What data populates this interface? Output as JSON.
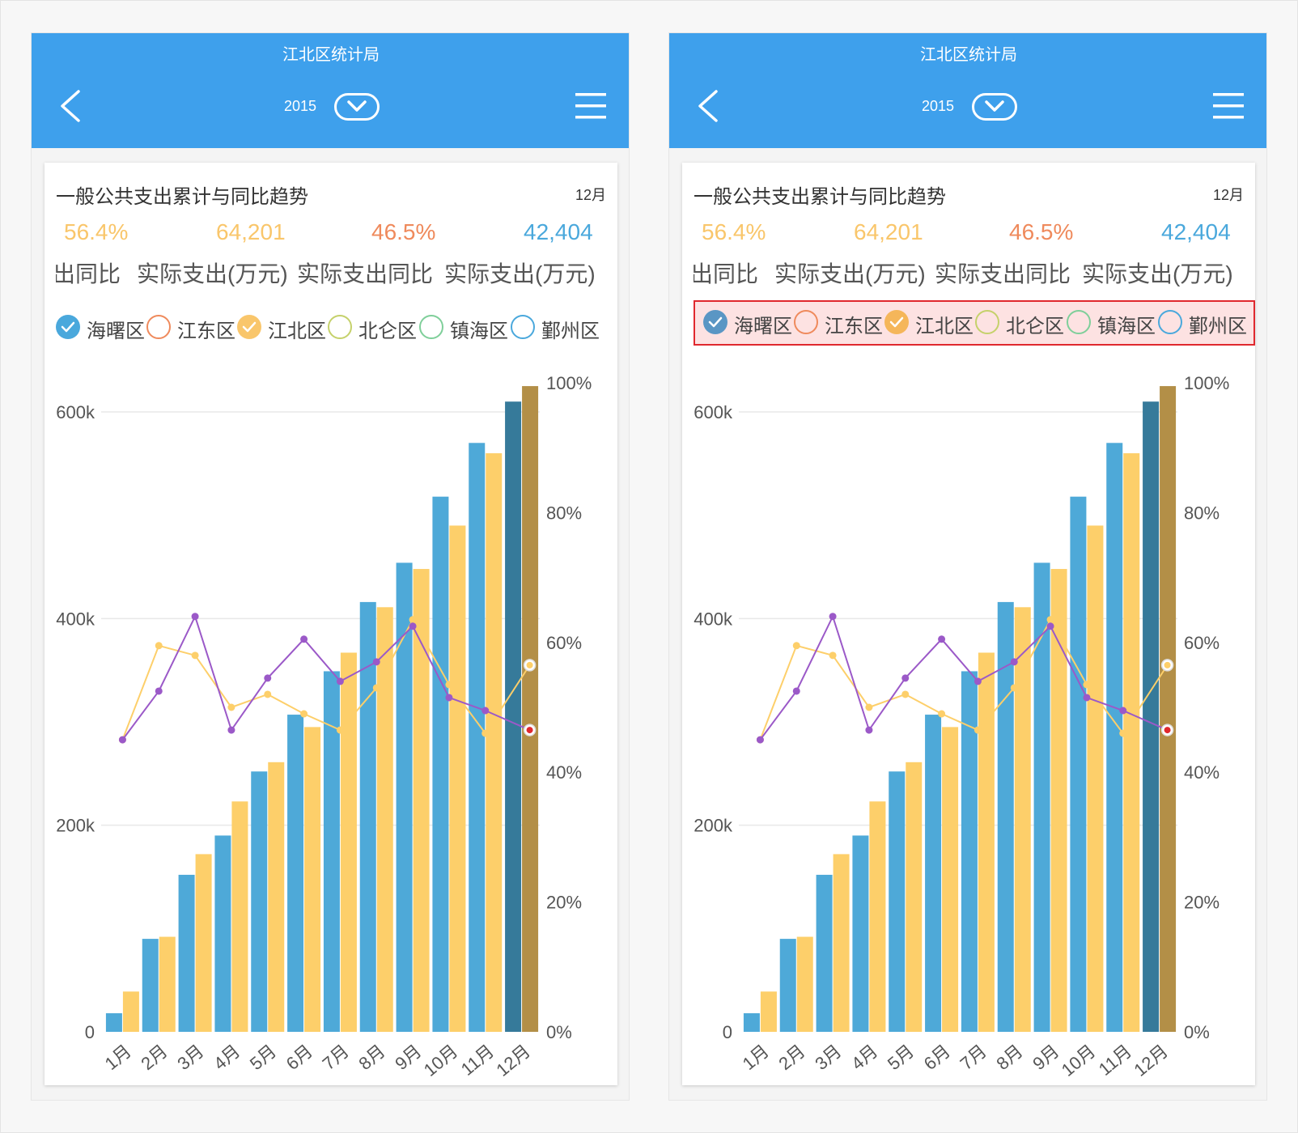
{
  "header": {
    "title": "江北区统计局",
    "year": "2015"
  },
  "card": {
    "title": "一般公共支出累计与同比趋势",
    "month": "12月",
    "kpis": [
      {
        "value": "56.4%",
        "color": "#f9c66b"
      },
      {
        "value": "64,201",
        "color": "#f9c66b"
      },
      {
        "value": "46.5%",
        "color": "#ef8a5c"
      },
      {
        "value": "42,404",
        "color": "#4aa8dc"
      }
    ],
    "kpi_labels": [
      "出同比",
      "实际支出(万元)",
      "实际支出同比",
      "实际支出(万元)"
    ]
  },
  "legend": [
    {
      "label": "海曙区",
      "color": "#4aa8dc",
      "checked": true
    },
    {
      "label": "江东区",
      "color": "#ef8a5c",
      "checked": false
    },
    {
      "label": "江北区",
      "color": "#f9c66b",
      "checked": true
    },
    {
      "label": "北仑区",
      "color": "#c5d16b",
      "checked": false
    },
    {
      "label": "镇海区",
      "color": "#7fcf9a",
      "checked": false
    },
    {
      "label": "鄞州区",
      "color": "#4aa8dc",
      "checked": false
    }
  ],
  "colors": {
    "bar_a": "#4ea9d8",
    "bar_b": "#fdcf6a",
    "bar_a_sel": "#367a9a",
    "bar_b_sel": "#b38f47",
    "line_a": "#9b59c8",
    "line_b": "#fdcf6a",
    "header": "#3ea0ec",
    "highlight": "#e0282e"
  },
  "chart_data": {
    "type": "bar",
    "categories": [
      "1月",
      "2月",
      "3月",
      "4月",
      "5月",
      "6月",
      "7月",
      "8月",
      "9月",
      "10月",
      "11月",
      "12月"
    ],
    "series": [
      {
        "values": [
          18000,
          90000,
          152000,
          190000,
          252000,
          307000,
          349000,
          416000,
          454000,
          518000,
          570000,
          610000
        ]
      },
      {
        "values": [
          39000,
          92000,
          172000,
          223000,
          261000,
          295000,
          367000,
          411000,
          448000,
          490000,
          560000,
          625000
        ]
      }
    ],
    "line_series": [
      {
        "values": [
          45,
          52.5,
          64,
          46.5,
          54.5,
          60.5,
          54,
          57,
          62.5,
          51.5,
          49.5,
          46.5
        ]
      },
      {
        "values": [
          45,
          59.5,
          58,
          50,
          52,
          49,
          46.5,
          53,
          63.5,
          53.5,
          46,
          56.5
        ]
      }
    ],
    "ylim": [
      0,
      600000
    ],
    "yticks": [
      "0",
      "200k",
      "400k",
      "600k"
    ],
    "y2lim": [
      0,
      100
    ],
    "y2ticks": [
      "0%",
      "20%",
      "40%",
      "60%",
      "80%",
      "100%"
    ],
    "xlabel": "",
    "ylabel": "",
    "grid": true
  }
}
